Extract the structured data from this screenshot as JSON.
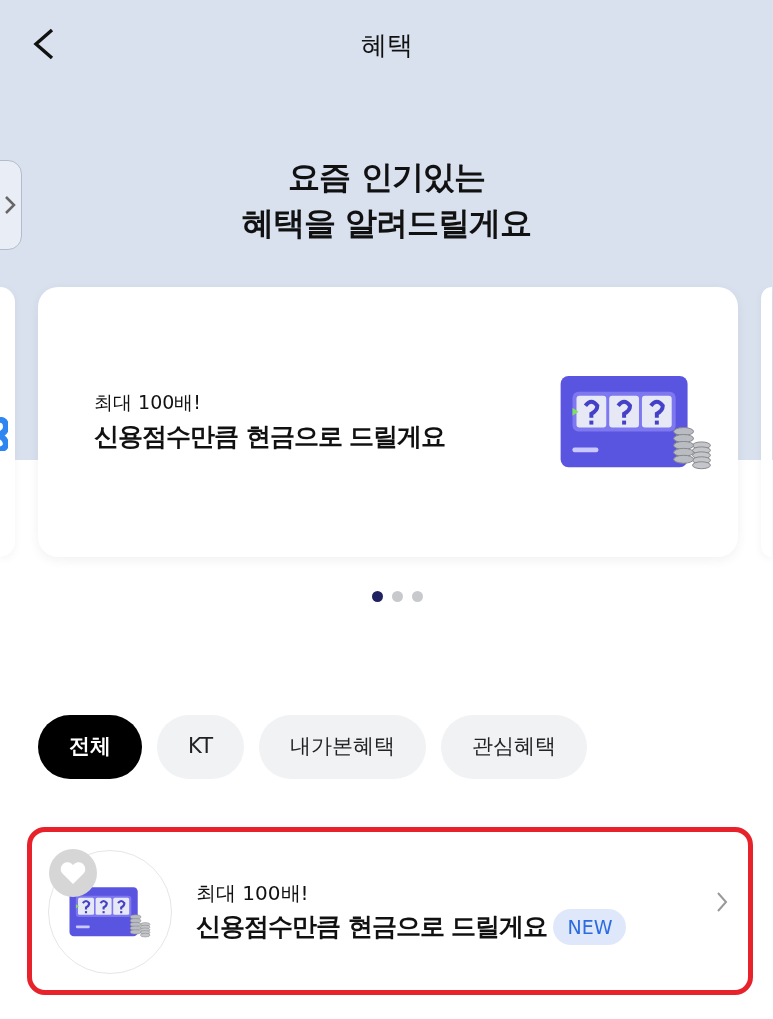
{
  "header": {
    "title": "혜택"
  },
  "headline": [
    "요즘 인기있는",
    "혜택을 알려드릴게요"
  ],
  "carousel": {
    "cards": [
      {
        "subtitle": "최대 100배!",
        "title": "신용점수만큼 현금으로 드릴게요"
      }
    ],
    "dots": [
      {
        "selected": true
      },
      {
        "selected": false
      },
      {
        "selected": false
      }
    ]
  },
  "filters": [
    {
      "label": "전체",
      "selected": true
    },
    {
      "label": "KT",
      "selected": false
    },
    {
      "label": "내가본혜택",
      "selected": false
    },
    {
      "label": "관심혜택",
      "selected": false
    }
  ],
  "benefits": [
    {
      "subtitle": "최대 100배!",
      "title": "신용점수만큼 현금으로 드릴게요",
      "badge": "NEW",
      "favorite": false,
      "highlighted": true
    }
  ]
}
